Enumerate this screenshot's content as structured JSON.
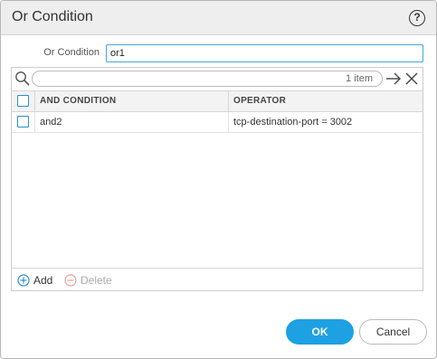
{
  "dialog": {
    "title": "Or Condition",
    "help_icon": "help-icon",
    "help_symbol": "?"
  },
  "or_condition": {
    "label": "Or Condition",
    "value": "or1"
  },
  "grid": {
    "search": {
      "placeholder": "",
      "item_count": "1 item",
      "search_icon": "search-icon",
      "apply_icon": "arrow-right-icon",
      "clear_icon": "close-icon"
    },
    "columns": [
      "AND CONDITION",
      "OPERATOR"
    ],
    "rows": [
      {
        "checked": false,
        "and_condition": "and2",
        "operator": "tcp-destination-port = 3002"
      }
    ],
    "footer": {
      "add_label": "Add",
      "add_icon": "add-circle-icon",
      "delete_label": "Delete",
      "delete_icon": "remove-circle-icon",
      "delete_enabled": false
    }
  },
  "buttons": {
    "ok_label": "OK",
    "cancel_label": "Cancel"
  },
  "colors": {
    "accent": "#1da1e2",
    "checkbox_border": "#2a8fce",
    "input_focus_border": "#3fa9db",
    "titlebar_bg": "#eeeeee",
    "disabled_text": "#aaaaaa"
  }
}
